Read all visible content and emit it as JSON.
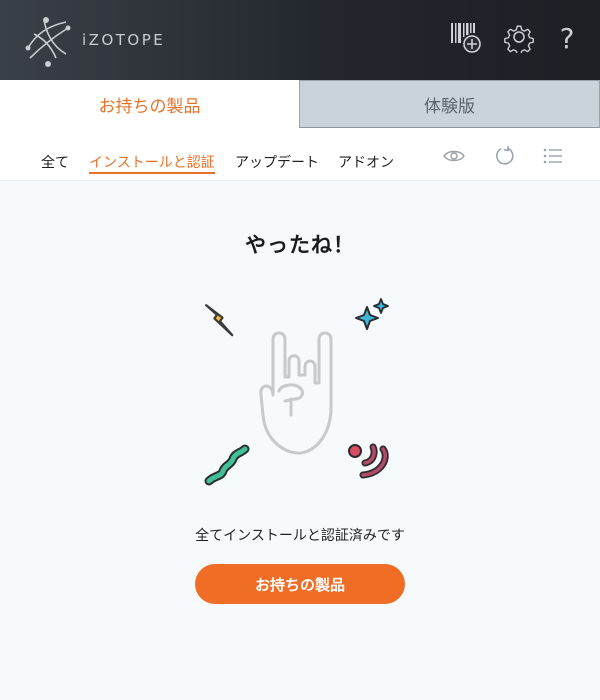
{
  "header": {
    "brand": "iZOTOPE",
    "icons": [
      "izotope-logo-icon",
      "add-serial-icon",
      "settings-gear-icon",
      "help-icon"
    ],
    "help_label": "?"
  },
  "tabs": [
    {
      "label": "お持ちの製品",
      "active": true
    },
    {
      "label": "体験版",
      "active": false
    }
  ],
  "filters": [
    {
      "label": "全て",
      "active": false
    },
    {
      "label": "インストールと認証",
      "active": true
    },
    {
      "label": "アップデート",
      "active": false
    },
    {
      "label": "アドオン",
      "active": false
    }
  ],
  "toolbar_icons": [
    "eye-icon",
    "refresh-icon",
    "list-view-icon"
  ],
  "main": {
    "headline": "やったね！",
    "message": "全てインストールと認証済みです",
    "cta_label": "お持ちの製品"
  },
  "colors": {
    "accent": "#e87128",
    "cta": "#f06d25",
    "header_bg": "#23272d",
    "inactive_tab": "#cbd3da"
  }
}
